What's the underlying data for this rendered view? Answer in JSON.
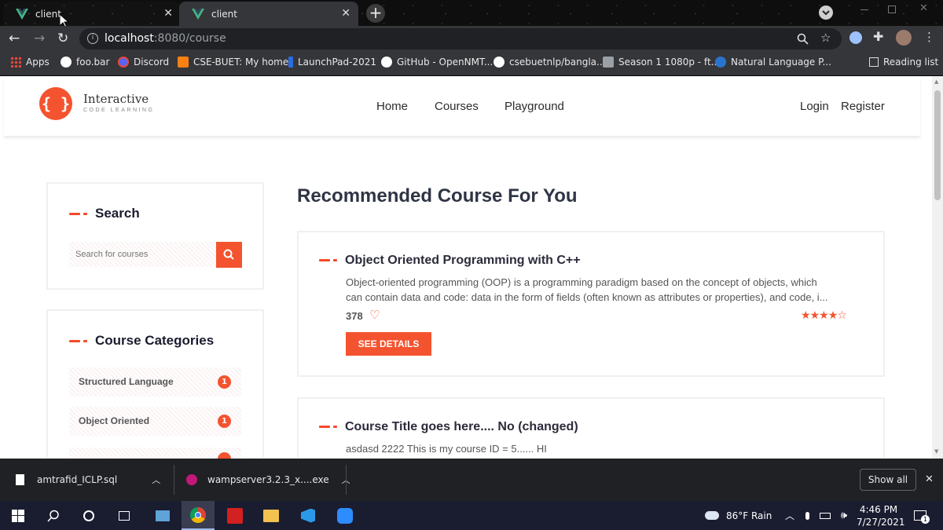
{
  "browser": {
    "tabs": [
      {
        "title": "client",
        "close": "✕"
      },
      {
        "title": "client",
        "close": "✕"
      }
    ],
    "new_tab": "+",
    "url_host": "localhost",
    "url_path": ":8080/course",
    "bookmarks": [
      {
        "label": "Apps",
        "icon": "apps-grid-icon"
      },
      {
        "label": "foo.bar",
        "icon": "foobar-icon"
      },
      {
        "label": "Discord",
        "icon": "discord-icon"
      },
      {
        "label": "CSE-BUET: My home",
        "icon": "moodle-icon"
      },
      {
        "label": "LaunchPad-2021",
        "icon": "launchpad-icon"
      },
      {
        "label": "GitHub - OpenNMT...",
        "icon": "github-icon"
      },
      {
        "label": "csebuetnlp/bangla...",
        "icon": "github-icon"
      },
      {
        "label": "Season 1 1080p - ft...",
        "icon": "folder-icon"
      },
      {
        "label": "Natural Language P...",
        "icon": "coursera-icon"
      }
    ],
    "reading_list": "Reading list"
  },
  "site": {
    "logo_title": "Interactive",
    "logo_subtitle": "CODE LEARNING",
    "nav": [
      "Home",
      "Courses",
      "Playground"
    ],
    "login": "Login",
    "register": "Register"
  },
  "sidebar": {
    "search_heading": "Search",
    "search_placeholder": "Search for courses",
    "categories_heading": "Course Categories",
    "categories": [
      {
        "label": "Structured Language",
        "count": "1"
      },
      {
        "label": "Object Oriented",
        "count": "1"
      }
    ]
  },
  "main": {
    "heading": "Recommended Course For You",
    "courses": [
      {
        "title": "Object Oriented Programming with C++",
        "desc_line1": "Object-oriented programming (OOP) is a programming paradigm based on the concept of objects, which",
        "desc_line2": "can contain data and code: data in the form of fields (often known as attributes or properties), and code, i...",
        "likes": "378",
        "rating": 4,
        "rating_max": 5,
        "button": "SEE DETAILS"
      },
      {
        "title": "Course Title goes here.... No (changed)",
        "desc_line1": "asdasd 2222 This is my course ID = 5...... HI"
      }
    ]
  },
  "downloads": {
    "items": [
      {
        "name": "amtrafid_ICLP.sql"
      },
      {
        "name": "wampserver3.2.3_x....exe"
      }
    ],
    "show_all": "Show all",
    "close": "✕"
  },
  "taskbar": {
    "weather": "86°F  Rain",
    "time": "4:46 PM",
    "date": "7/27/2021",
    "notification_count": "1"
  },
  "colors": {
    "accent": "#f4532f",
    "vue_green": "#41b883"
  }
}
